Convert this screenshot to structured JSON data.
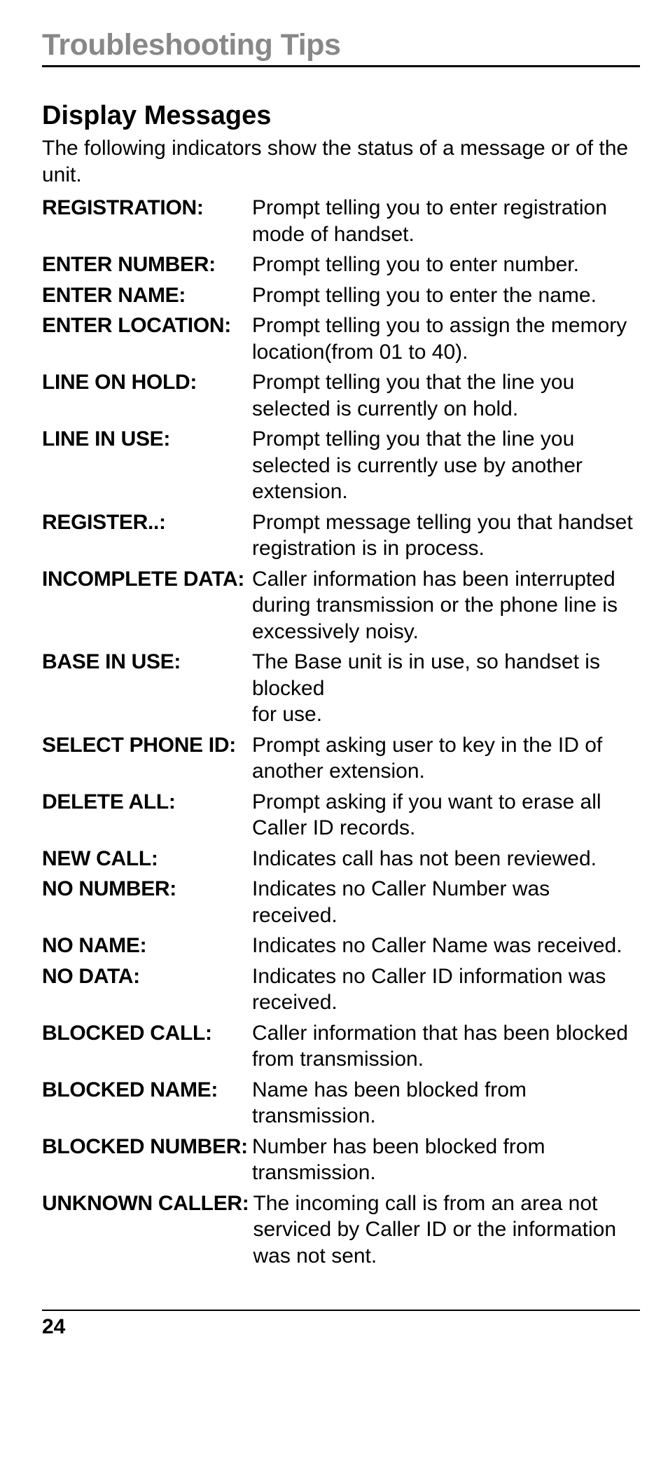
{
  "title": "Troubleshooting Tips",
  "section": "Display Messages",
  "intro": "The following indicators show the status of a message or of the unit.",
  "items": [
    {
      "term": "REGISTRATION:",
      "desc": "Prompt telling you to enter registration mode of handset."
    },
    {
      "term": "ENTER NUMBER:",
      "desc": "Prompt telling you to enter number."
    },
    {
      "term": "ENTER NAME:",
      "desc": "Prompt telling you to enter the name."
    },
    {
      "term": "ENTER LOCATION:",
      "desc": "Prompt telling you to assign the memory location(from 01 to 40)."
    },
    {
      "term": "LINE ON HOLD:",
      "desc": "Prompt telling you that the line you selected is currently on hold."
    },
    {
      "term": "LINE IN USE:",
      "desc": "Prompt telling you that the line you selected is currently use by another extension."
    },
    {
      "term": "REGISTER..:",
      "desc": "Prompt message telling you that handset registration is in process."
    },
    {
      "term": "INCOMPLETE DATA:",
      "desc": "Caller information has been interrupted during transmission or the phone line is excessively noisy."
    },
    {
      "term": "BASE IN USE:",
      "desc": "The Base unit is in use, so handset is blocked\nfor use."
    },
    {
      "term": "SELECT PHONE ID:",
      "desc": "Prompt asking user to key in the ID of another extension."
    },
    {
      "term": "DELETE ALL:",
      "desc": "Prompt asking if you want to erase all Caller ID records."
    },
    {
      "term": "NEW CALL:",
      "desc": "Indicates call has not been reviewed."
    },
    {
      "term": "NO NUMBER:",
      "desc": "Indicates no Caller Number was received."
    },
    {
      "term": "NO NAME:",
      "desc": "Indicates no Caller Name was received."
    },
    {
      "term": "NO DATA:",
      "desc": "Indicates no Caller ID information was received."
    },
    {
      "term": "BLOCKED CALL:",
      "desc": "Caller information that has been blocked from transmission."
    },
    {
      "term": "BLOCKED NAME:",
      "desc": "Name has been blocked from transmission."
    },
    {
      "term": "BLOCKED NUMBER:",
      "desc": "Number has been blocked from transmission."
    },
    {
      "term": "UNKNOWN CALLER:",
      "desc": "The incoming call is from an area not serviced by Caller ID or the information was not sent."
    }
  ],
  "page_number": "24"
}
